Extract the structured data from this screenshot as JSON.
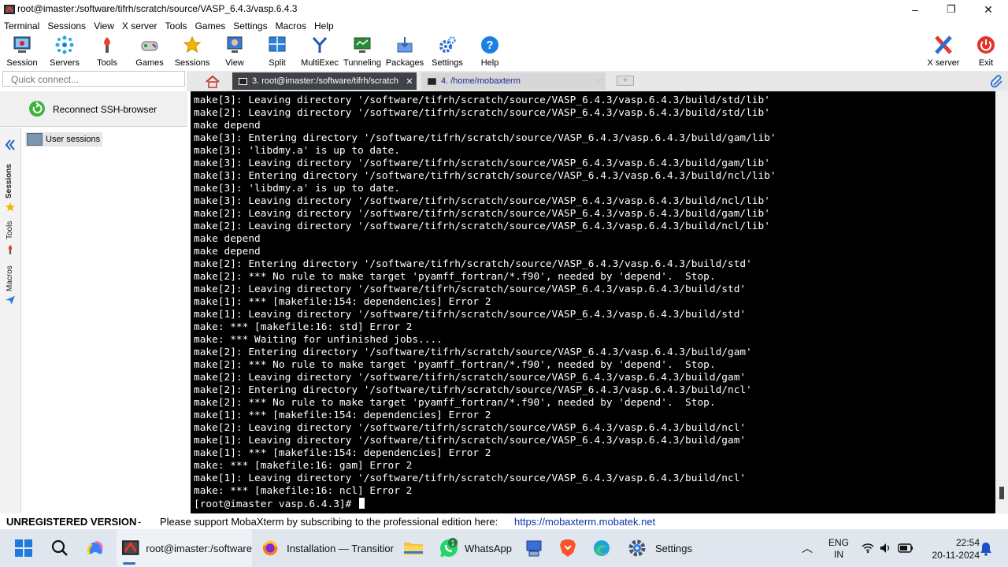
{
  "window": {
    "title": "root@imaster:/software/tifrh/scratch/source/VASP_6.4.3/vasp.6.4.3",
    "controls": {
      "minimize": "–",
      "maximize": "❐",
      "close": "✕"
    }
  },
  "menu": [
    "Terminal",
    "Sessions",
    "View",
    "X server",
    "Tools",
    "Games",
    "Settings",
    "Macros",
    "Help"
  ],
  "toolbar": {
    "session": "Session",
    "servers": "Servers",
    "tools": "Tools",
    "games": "Games",
    "sessions": "Sessions",
    "view": "View",
    "split": "Split",
    "multiexec": "MultiExec",
    "tunneling": "Tunneling",
    "packages": "Packages",
    "settings": "Settings",
    "help": "Help",
    "xserver": "X server",
    "exit": "Exit"
  },
  "quick_connect": {
    "placeholder": "Quick connect..."
  },
  "tabs": {
    "active_label": "3. root@imaster:/software/tifrh/scratch",
    "inactive_label": "4. /home/mobaxterm",
    "close_glyph": "✕"
  },
  "left_panel": {
    "reconnect_label": "Reconnect SSH-browser",
    "side_tabs": {
      "sessions": "Sessions",
      "tools": "Tools",
      "macros": "Macros"
    },
    "user_sessions_label": "User sessions"
  },
  "terminal": {
    "lines": [
      "make[3]: Leaving directory '/software/tifrh/scratch/source/VASP_6.4.3/vasp.6.4.3/build/std/lib'",
      "make[2]: Leaving directory '/software/tifrh/scratch/source/VASP_6.4.3/vasp.6.4.3/build/std/lib'",
      "make depend",
      "make[3]: Entering directory '/software/tifrh/scratch/source/VASP_6.4.3/vasp.6.4.3/build/gam/lib'",
      "make[3]: 'libdmy.a' is up to date.",
      "make[3]: Leaving directory '/software/tifrh/scratch/source/VASP_6.4.3/vasp.6.4.3/build/gam/lib'",
      "make[3]: Entering directory '/software/tifrh/scratch/source/VASP_6.4.3/vasp.6.4.3/build/ncl/lib'",
      "make[3]: 'libdmy.a' is up to date.",
      "make[3]: Leaving directory '/software/tifrh/scratch/source/VASP_6.4.3/vasp.6.4.3/build/ncl/lib'",
      "make[2]: Leaving directory '/software/tifrh/scratch/source/VASP_6.4.3/vasp.6.4.3/build/gam/lib'",
      "make[2]: Leaving directory '/software/tifrh/scratch/source/VASP_6.4.3/vasp.6.4.3/build/ncl/lib'",
      "make depend",
      "make depend",
      "make[2]: Entering directory '/software/tifrh/scratch/source/VASP_6.4.3/vasp.6.4.3/build/std'",
      "make[2]: *** No rule to make target 'pyamff_fortran/*.f90', needed by 'depend'.  Stop.",
      "make[2]: Leaving directory '/software/tifrh/scratch/source/VASP_6.4.3/vasp.6.4.3/build/std'",
      "make[1]: *** [makefile:154: dependencies] Error 2",
      "make[1]: Leaving directory '/software/tifrh/scratch/source/VASP_6.4.3/vasp.6.4.3/build/std'",
      "make: *** [makefile:16: std] Error 2",
      "make: *** Waiting for unfinished jobs....",
      "make[2]: Entering directory '/software/tifrh/scratch/source/VASP_6.4.3/vasp.6.4.3/build/gam'",
      "make[2]: *** No rule to make target 'pyamff_fortran/*.f90', needed by 'depend'.  Stop.",
      "make[2]: Leaving directory '/software/tifrh/scratch/source/VASP_6.4.3/vasp.6.4.3/build/gam'",
      "make[2]: Entering directory '/software/tifrh/scratch/source/VASP_6.4.3/vasp.6.4.3/build/ncl'",
      "make[2]: *** No rule to make target 'pyamff_fortran/*.f90', needed by 'depend'.  Stop.",
      "make[1]: *** [makefile:154: dependencies] Error 2",
      "make[2]: Leaving directory '/software/tifrh/scratch/source/VASP_6.4.3/vasp.6.4.3/build/ncl'",
      "make[1]: Leaving directory '/software/tifrh/scratch/source/VASP_6.4.3/vasp.6.4.3/build/gam'",
      "make[1]: *** [makefile:154: dependencies] Error 2",
      "make: *** [makefile:16: gam] Error 2",
      "make[1]: Leaving directory '/software/tifrh/scratch/source/VASP_6.4.3/vasp.6.4.3/build/ncl'",
      "make: *** [makefile:16: ncl] Error 2",
      "[root@imaster vasp.6.4.3]# "
    ]
  },
  "status": {
    "unregistered": "UNREGISTERED VERSION",
    "separator": "-",
    "message": "Please support MobaXterm by subscribing to the professional edition here:",
    "link": "https://mobaxterm.mobatek.net"
  },
  "taskbar": {
    "mobaxterm_label": "root@imaster:/software",
    "firefox_label": "Installation — Transitior",
    "whatsapp_label": "WhatsApp",
    "whatsapp_badge": "1",
    "settings_label": "Settings",
    "lang_line1": "ENG",
    "lang_line2": "IN",
    "time": "22:54",
    "date": "20-11-2024"
  },
  "colors": {
    "terminal_bg": "#000000",
    "terminal_fg": "#ffffff",
    "terminal_blue": "#6eb6ff",
    "terminal_red": "#ff5a50",
    "tab_active_bg": "#3f4347",
    "link": "#0a36a8"
  },
  "icons": [
    "session-icon",
    "servers-icon",
    "tools-icon",
    "games-icon",
    "sessions-star-icon",
    "view-icon",
    "split-icon",
    "multiexec-icon",
    "tunneling-icon",
    "packages-icon",
    "settings-gear-icon",
    "help-icon",
    "xserver-icon",
    "exit-power-icon"
  ]
}
